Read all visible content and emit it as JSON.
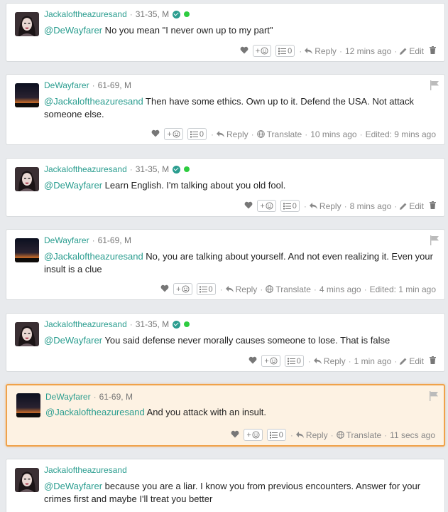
{
  "common": {
    "reply_label": "Reply",
    "translate_label": "Translate",
    "edit_label": "Edit",
    "react_label": "+",
    "list_count": "0",
    "dot": "·"
  },
  "comments": [
    {
      "author": "Jackaloftheazuresand",
      "age_gender": "31-35, M",
      "verified": true,
      "online": true,
      "mention": "@DeWayfarer",
      "text": " No you mean \"I never own up to my part\"",
      "time": "12 mins ago",
      "edited": "",
      "owner": true
    },
    {
      "author": "DeWayfarer",
      "age_gender": "61-69, M",
      "verified": false,
      "online": false,
      "mention": "@Jackaloftheazuresand",
      "text": " Then have some ethics. Own up to it. Defend the USA. Not attack someone else.",
      "time": "10 mins ago",
      "edited": "Edited: 9 mins ago",
      "owner": false
    },
    {
      "author": "Jackaloftheazuresand",
      "age_gender": "31-35, M",
      "verified": true,
      "online": true,
      "mention": "@DeWayfarer",
      "text": " Learn English. I'm talking about you old fool.",
      "time": "8 mins ago",
      "edited": "",
      "owner": true
    },
    {
      "author": "DeWayfarer",
      "age_gender": "61-69, M",
      "verified": false,
      "online": false,
      "mention": "@Jackaloftheazuresand",
      "text": " No, you are talking about yourself. And not even realizing it. Even your insult is a clue",
      "time": "4 mins ago",
      "edited": "Edited: 1 min ago",
      "owner": false
    },
    {
      "author": "Jackaloftheazuresand",
      "age_gender": "31-35, M",
      "verified": true,
      "online": true,
      "mention": "@DeWayfarer",
      "text": " You said defense never morally causes someone to lose. That is false",
      "time": "1 min ago",
      "edited": "",
      "owner": true
    },
    {
      "author": "DeWayfarer",
      "age_gender": "61-69, M",
      "verified": false,
      "online": false,
      "mention": "@Jackaloftheazuresand",
      "text": " And you attack with an insult.",
      "time": "11 secs ago",
      "edited": "",
      "owner": false,
      "highlighted": true
    },
    {
      "author": "Jackaloftheazuresand",
      "age_gender": "",
      "verified": false,
      "online": false,
      "mention": "@DeWayfarer",
      "text": " because you are a liar. I know you from previous encounters. Answer for your crimes first and maybe I'll treat you better",
      "time": "",
      "edited": "",
      "owner": true
    }
  ],
  "colors": {
    "accent": "#2a9d8f",
    "highlight_border": "#f0a24a",
    "highlight_bg": "#fdf2e3",
    "online": "#2ecc40"
  }
}
